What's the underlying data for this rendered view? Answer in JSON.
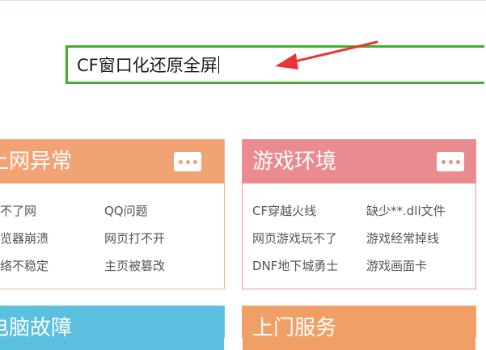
{
  "search": {
    "value": "CF窗口化还原全屏"
  },
  "colors": {
    "search_border": "#3db12a",
    "arrow": "#e8353a",
    "card_network": "#f2a373",
    "card_game": "#ea8b8f",
    "card_computer": "#5bbfe0",
    "card_service": "#f0a067"
  },
  "cards": [
    {
      "title": "上网异常",
      "more_icon": "more-dots-icon",
      "links": [
        "上不了网",
        "QQ问题",
        "浏览器崩溃",
        "网页打不开",
        "网络不稳定",
        "主页被篡改"
      ]
    },
    {
      "title": "游戏环境",
      "more_icon": "more-dots-icon",
      "links": [
        "CF穿越火线",
        "缺少**.dll文件",
        "网页游戏玩不了",
        "游戏经常掉线",
        "DNF地下城勇士",
        "游戏画面卡"
      ]
    },
    {
      "title": "电脑故障"
    },
    {
      "title": "上门服务"
    }
  ]
}
